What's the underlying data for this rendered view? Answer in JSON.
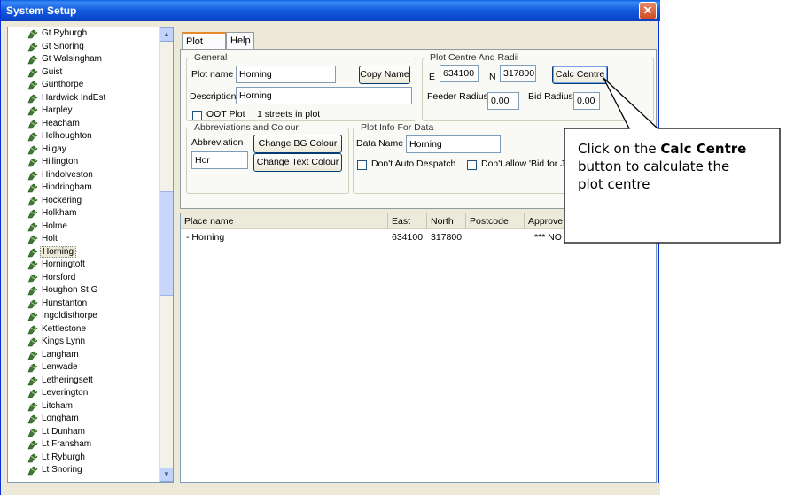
{
  "window": {
    "title": "System Setup",
    "close_glyph": "✕"
  },
  "tree": {
    "items": [
      "Gt Ryburgh",
      "Gt Snoring",
      "Gt Walsingham",
      "Guist",
      "Gunthorpe",
      "Hardwick IndEst",
      "Harpley",
      "Heacham",
      "Helhoughton",
      "Hilgay",
      "Hillington",
      "Hindolveston",
      "Hindringham",
      "Hockering",
      "Holkham",
      "Holme",
      "Holt",
      "Horning",
      "Horningtoft",
      "Horsford",
      "Houghon St G",
      "Hunstanton",
      "Ingoldisthorpe",
      "Kettlestone",
      "Kings Lynn",
      "Langham",
      "Lenwade",
      "Letheringsett",
      "Leverington",
      "Litcham",
      "Longham",
      "Lt Dunham",
      "Lt Fransham",
      "Lt Ryburgh",
      "Lt Snoring"
    ],
    "selected": "Horning",
    "icon": "place-icon"
  },
  "tabs": [
    "Plot Info",
    "Help"
  ],
  "general": {
    "legend": "General",
    "plot_name_label": "Plot name",
    "plot_name": "Horning",
    "copy_name": "Copy Name",
    "description_label": "Description",
    "description": "Horning",
    "oot_label": "OOT Plot",
    "streets": "1 streets in plot"
  },
  "centre": {
    "legend": "Plot Centre And Radii",
    "e_label": "E",
    "e": "634100",
    "n_label": "N",
    "n": "317800",
    "calc_centre": "Calc Centre",
    "feeder_label": "Feeder Radius",
    "feeder": "0.00",
    "bid_label": "Bid Radius",
    "bid": "0.00"
  },
  "abbrev": {
    "legend": "Abbreviations and Colour",
    "abbrev_label": "Abbreviation",
    "abbrev": "Hor",
    "bg_button": "Change BG Colour",
    "text_button": "Change Text Colour"
  },
  "plotdata": {
    "legend": "Plot Info For Data",
    "data_name_label": "Data Name",
    "data_name": "Horning",
    "auto_despatch": "Don't Auto Despatch",
    "bid_for_jobs": "Don't allow 'Bid for Jo"
  },
  "list": {
    "columns": [
      "Place name",
      "East",
      "North",
      "Postcode",
      "Approve"
    ],
    "rows": [
      {
        "place": "- Horning",
        "east": "634100",
        "north": "317800",
        "postcode": "",
        "approve": "*** NO *"
      }
    ]
  },
  "callout": {
    "before": "Click on the ",
    "bold": "Calc Centre",
    "after": " button to calculate the plot centre"
  },
  "colors": {
    "titlebar": "#0a46cc",
    "callout_border": "#000000",
    "tab_accent": "#e68b2c"
  }
}
